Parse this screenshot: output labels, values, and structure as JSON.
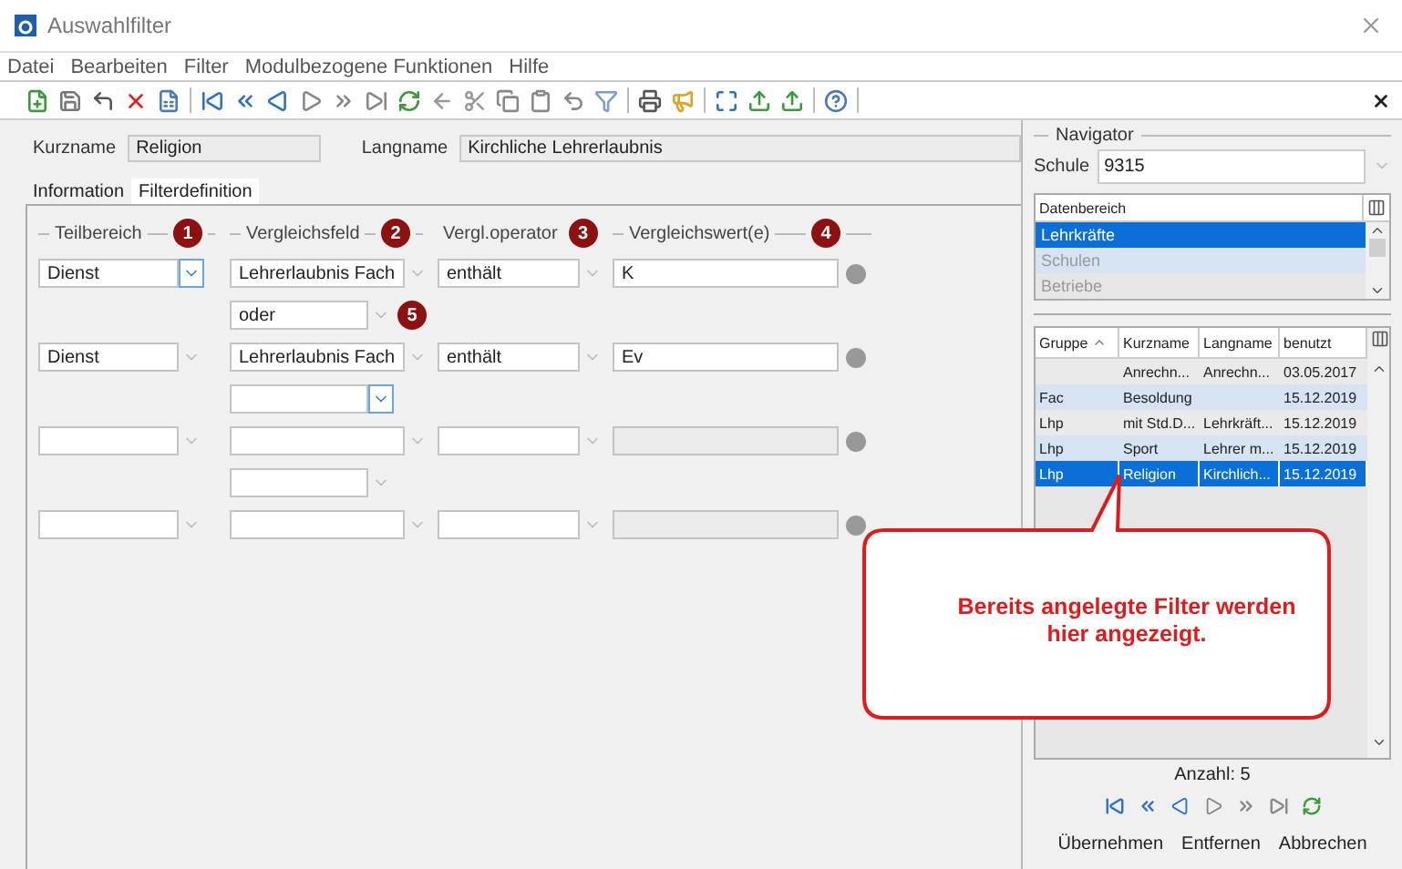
{
  "window": {
    "title": "Auswahlfilter"
  },
  "menu": [
    "Datei",
    "Bearbeiten",
    "Filter",
    "Modulbezogene Funktionen",
    "Hilfe"
  ],
  "header": {
    "kurzname_label": "Kurzname",
    "kurzname": "Religion",
    "langname_label": "Langname",
    "langname": "Kirchliche Lehrerlaubnis"
  },
  "tabs": [
    {
      "label": "Information",
      "selected": false
    },
    {
      "label": "Filterdefinition",
      "selected": true
    }
  ],
  "filter": {
    "columns": [
      {
        "label": "Teilbereich",
        "badge": "1"
      },
      {
        "label": "Vergleichsfeld",
        "badge": "2"
      },
      {
        "label": "Vergl.operator",
        "badge": "3"
      },
      {
        "label": "Vergleichswert(e)",
        "badge": "4"
      }
    ],
    "rows": [
      {
        "kind": "criterion",
        "teilbereich": "Dienst",
        "feld": "Lehrerlaubnis Fach",
        "operator": "enthält",
        "wert": "K",
        "focused": true,
        "disabled": false
      },
      {
        "kind": "connector",
        "value": "oder",
        "badge": "5",
        "focused": false
      },
      {
        "kind": "criterion",
        "teilbereich": "Dienst",
        "feld": "Lehrerlaubnis Fach",
        "operator": "enthält",
        "wert": "Ev",
        "focused": false,
        "disabled": false
      },
      {
        "kind": "connector",
        "focused": true
      },
      {
        "kind": "criterion",
        "focused": false,
        "disabled": true
      },
      {
        "kind": "connector",
        "focused": false
      },
      {
        "kind": "criterion",
        "focused": false,
        "disabled": true
      }
    ]
  },
  "navigator": {
    "title": "Navigator",
    "schule_label": "Schule",
    "schule": "9315",
    "datenbereich": {
      "header": "Datenbereich",
      "items": [
        {
          "label": "Lehrkräfte",
          "selected": true,
          "disabled": false
        },
        {
          "label": "Schulen",
          "selected": false,
          "disabled": true
        },
        {
          "label": "Betriebe",
          "selected": false,
          "disabled": true
        }
      ]
    },
    "table": {
      "columns": [
        {
          "label": "Gruppe",
          "sorted": true
        },
        {
          "label": "Kurzname"
        },
        {
          "label": "Langname"
        },
        {
          "label": "benutzt"
        }
      ],
      "rows": [
        {
          "kurzname": "Anrechn...",
          "langname": "Anrechn...",
          "benutzt": "03.05.2017",
          "selected": false
        },
        {
          "gruppe": "Fac",
          "kurzname": "Besoldung",
          "benutzt": "15.12.2019",
          "selected": false
        },
        {
          "gruppe": "Lhp",
          "kurzname": "mit Std.D...",
          "langname": "Lehrkräft...",
          "benutzt": "15.12.2019",
          "selected": false
        },
        {
          "gruppe": "Lhp",
          "kurzname": "Sport",
          "langname": "Lehrer m...",
          "benutzt": "15.12.2019",
          "selected": false
        },
        {
          "gruppe": "Lhp",
          "kurzname": "Religion",
          "langname": "Kirchlich...",
          "benutzt": "15.12.2019",
          "selected": true
        }
      ]
    },
    "count": "Anzahl: 5",
    "buttons": [
      "Übernehmen",
      "Entfernen",
      "Abbrechen"
    ]
  },
  "callout": "Bereits angelegte Filter werden hier angezeigt."
}
